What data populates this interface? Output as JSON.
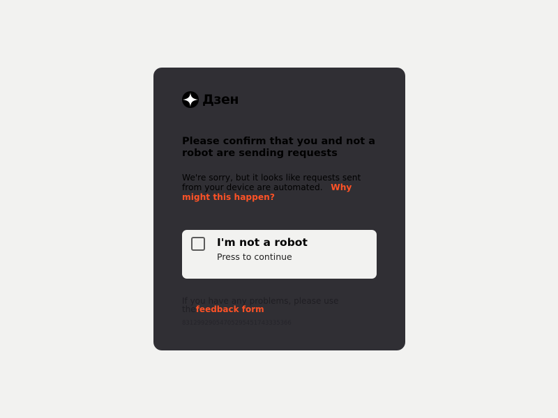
{
  "logo": {
    "icon": "dzen-star-icon",
    "text": "Дзен"
  },
  "title": "Please confirm that you and not a robot are sending requests",
  "description": {
    "text": "We're sorry, but it looks like requests sent from your device are automated.",
    "link_label": "Why might this happen?"
  },
  "captcha": {
    "label": "I'm not a robot",
    "sublabel": "Press to continue",
    "checked": false
  },
  "help": {
    "text": "If you have any problems, please use the",
    "link_label": "feedback form"
  },
  "request_id": "83129929054705295451743335366",
  "colors": {
    "page_background": "#f2f2f0",
    "card_background": "#302f34",
    "accent": "#ff5226",
    "captcha_background": "#f2f2f0"
  }
}
